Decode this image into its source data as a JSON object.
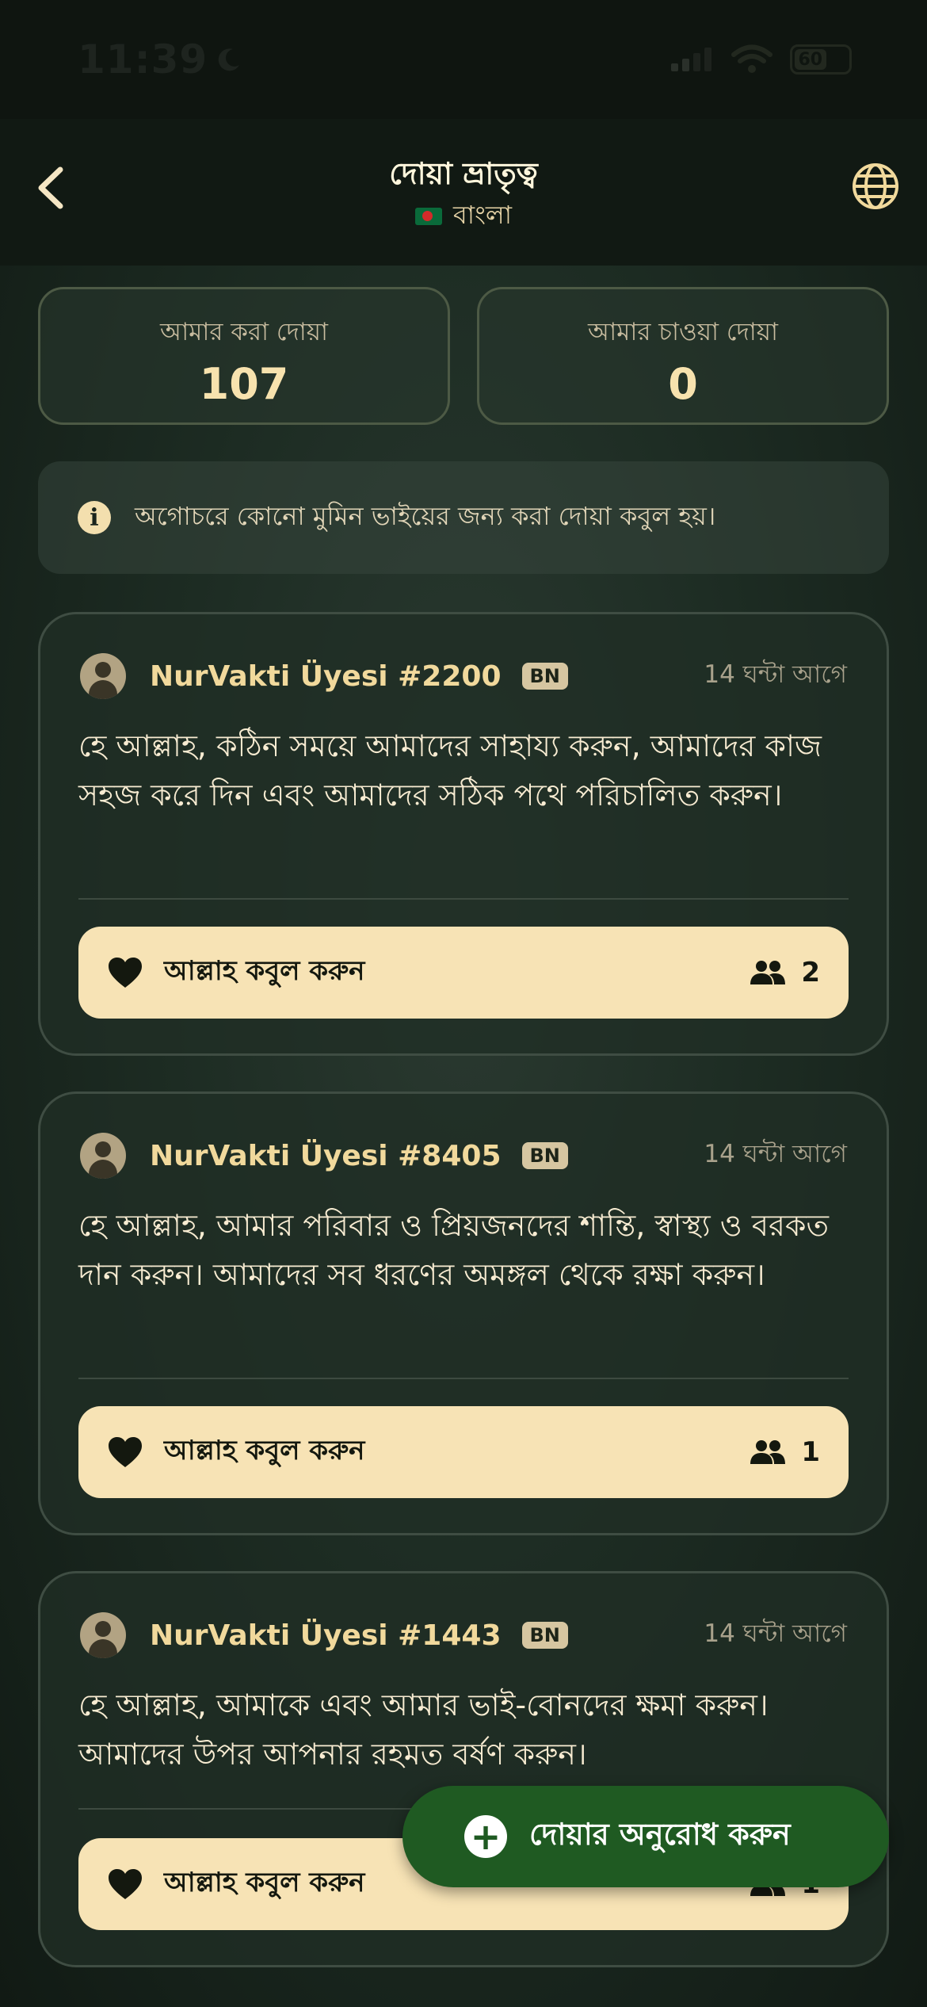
{
  "status_bar": {
    "time": "11:39",
    "battery": "60"
  },
  "header": {
    "title": "দোয়া ভ্রাতৃত্ব",
    "language": "বাংলা"
  },
  "stats": [
    {
      "label": "আমার করা দোয়া",
      "value": "107"
    },
    {
      "label": "আমার চাওয়া দোয়া",
      "value": "0"
    }
  ],
  "info": {
    "text": "অগোচরে কোনো মুমিন ভাইয়ের জন্য করা দোয়া কবুল হয়।"
  },
  "cards": [
    {
      "user": "NurVakti Üyesi #2200",
      "lang": "BN",
      "time": "14 ঘন্টা আগে",
      "text": "হে আল্লাহ, কঠিন সময়ে আমাদের সাহায্য করুন, আমাদের কাজ সহজ করে দিন এবং আমাদের সঠিক পথে পরিচালিত করুন।",
      "button": "আল্লাহ কবুল করুন",
      "count": "2"
    },
    {
      "user": "NurVakti Üyesi #8405",
      "lang": "BN",
      "time": "14 ঘন্টা আগে",
      "text": "হে আল্লাহ, আমার পরিবার ও প্রিয়জনদের শান্তি, স্বাস্থ্য ও বরকত দান করুন। আমাদের সব ধরণের অমঙ্গল থেকে রক্ষা করুন।",
      "button": "আল্লাহ কবুল করুন",
      "count": "1"
    },
    {
      "user": "NurVakti Üyesi #1443",
      "lang": "BN",
      "time": "14 ঘন্টা আগে",
      "text": "হে আল্লাহ, আমাকে এবং আমার ভাই-বোনদের ক্ষমা করুন। আমাদের উপর আপনার রহমত বর্ষণ করুন।",
      "button": "আল্লাহ কবুল করুন",
      "count": "1"
    }
  ],
  "fab": {
    "label": "দোয়ার অনুরোধ করুন"
  },
  "colors": {
    "accent": "#f7e3b5",
    "fab": "#1f5a22",
    "gold_text": "#f1d99c"
  }
}
